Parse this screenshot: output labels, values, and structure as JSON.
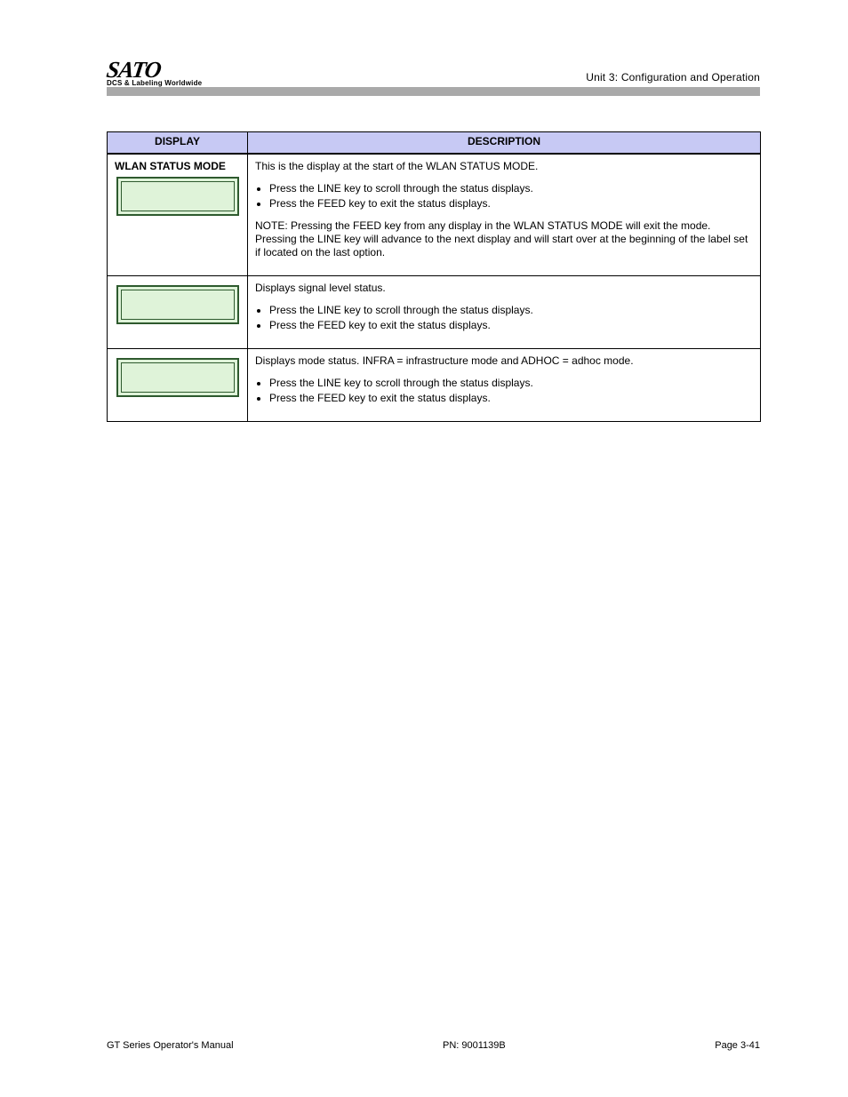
{
  "header": {
    "logo_text": "SATO",
    "logo_tagline": "DCS & Labeling Worldwide",
    "section_heading": "Unit 3: Configuration and Operation"
  },
  "table": {
    "head_display": "DISPLAY",
    "head_description": "DESCRIPTION",
    "rows": [
      {
        "step_title": "WLAN STATUS MODE",
        "lcd_line1": "",
        "lcd_line2": "",
        "description_p1": "This is the display at the start of the WLAN STATUS MODE.",
        "bullets": [
          "Press the LINE key to scroll through the status displays.",
          "Press the FEED key to exit the status displays."
        ],
        "description_p2": "NOTE: Pressing the FEED key from any display in the WLAN STATUS MODE will exit the mode. Pressing the LINE key will advance to the next display and will start over at the beginning of the label set if located on the last option."
      },
      {
        "step_title": "",
        "lcd_line1": "",
        "lcd_line2": "",
        "description_p1": "Displays signal level status.",
        "bullets": [
          "Press the LINE key to scroll through the status displays.",
          "Press the FEED key to exit the status displays."
        ],
        "description_p2": ""
      },
      {
        "step_title": "",
        "lcd_line1": "",
        "lcd_line2": "",
        "description_p1": "Displays mode status. INFRA = infrastructure mode and ADHOC = adhoc mode.",
        "bullets": [
          "Press the LINE key to scroll through the status displays.",
          "Press the FEED key to exit the status displays."
        ],
        "description_p2": ""
      }
    ]
  },
  "footer": {
    "doc_title": "GT Series Operator's Manual",
    "page_number": "PN: 9001139B",
    "page": "Page 3-41"
  }
}
